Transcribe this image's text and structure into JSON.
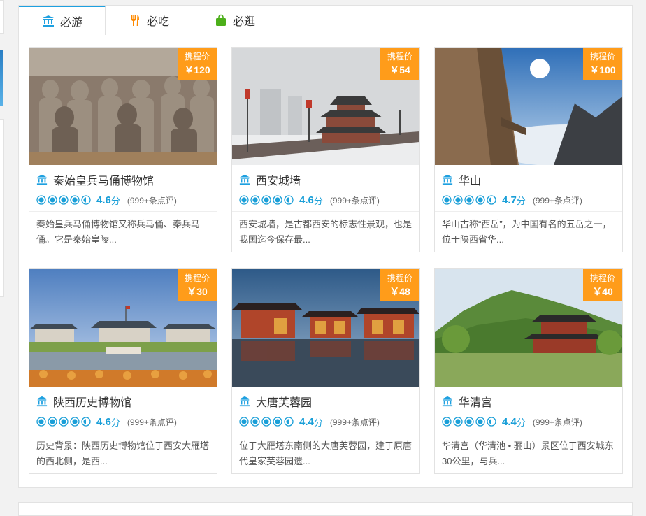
{
  "tabs": [
    {
      "label": "必游",
      "icon": "bank-icon",
      "active": true
    },
    {
      "label": "必吃",
      "icon": "fork-knife-icon",
      "active": false
    },
    {
      "label": "必逛",
      "icon": "shopping-bag-icon",
      "active": false
    }
  ],
  "colors": {
    "accent": "#1ea0e0",
    "price_bg": "#ff9c1a",
    "score": "#1a9fd8"
  },
  "price_label": "携程价",
  "cards": [
    {
      "name": "秦始皇兵马俑博物馆",
      "price": "￥120",
      "score": "4.6",
      "fen": "分",
      "stars": 4.5,
      "reviews": "(999+条点评)",
      "desc": "秦始皇兵马俑博物馆又称兵马俑、秦兵马俑。它是秦始皇陵..."
    },
    {
      "name": "西安城墙",
      "price": "￥54",
      "score": "4.6",
      "fen": "分",
      "stars": 4.5,
      "reviews": "(999+条点评)",
      "desc": "西安城墙，是古都西安的标志性景观，也是我国迄今保存最..."
    },
    {
      "name": "华山",
      "price": "￥100",
      "score": "4.7",
      "fen": "分",
      "stars": 4.5,
      "reviews": "(999+条点评)",
      "desc": "华山古称“西岳”，为中国有名的五岳之一，位于陕西省华..."
    },
    {
      "name": "陕西历史博物馆",
      "price": "￥30",
      "score": "4.6",
      "fen": "分",
      "stars": 4.5,
      "reviews": "(999+条点评)",
      "desc": "历史背景：陕西历史博物馆位于西安大雁塔的西北侧，是西..."
    },
    {
      "name": "大唐芙蓉园",
      "price": "￥48",
      "score": "4.4",
      "fen": "分",
      "stars": 4.5,
      "reviews": "(999+条点评)",
      "desc": "位于大雁塔东南侧的大唐芙蓉园，建于原唐代皇家芙蓉园遗..."
    },
    {
      "name": "华清宫",
      "price": "￥40",
      "score": "4.4",
      "fen": "分",
      "stars": 4.5,
      "reviews": "(999+条点评)",
      "desc": "华清宫（华清池 • 骊山）景区位于西安城东30公里，与兵..."
    }
  ]
}
